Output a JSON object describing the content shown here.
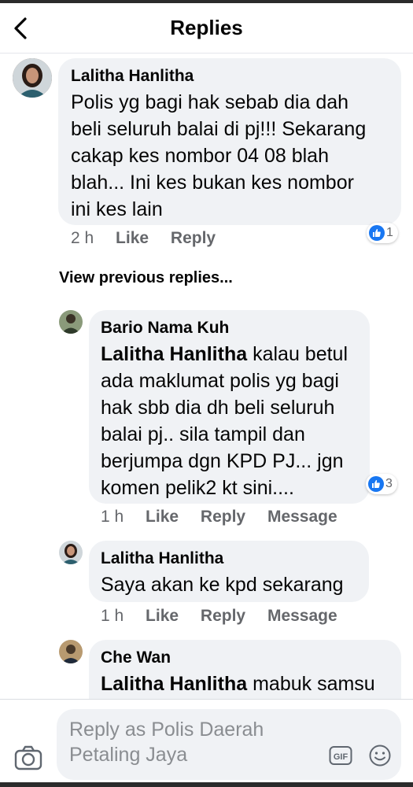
{
  "header": {
    "title": "Replies"
  },
  "comments": [
    {
      "author": "Lalitha Hanlitha",
      "lines": [
        "Polis yg bagi hak sebab dia dah",
        "beli seluruh balai di pj!!! Sekarang",
        "cakap kes nombor 04 08 blah",
        "blah... Ini kes bukan kes nombor",
        "ini kes lain"
      ],
      "time": "2 h",
      "like": "Like",
      "reply": "Reply",
      "reaction_count": "1"
    },
    {
      "author": "Bario Nama Kuh",
      "mention": "Lalitha Hanlitha",
      "first_line_rest": " kalau betul",
      "lines": [
        "ada maklumat polis yg bagi",
        "hak sbb dia dh beli seluruh",
        "balai pj.. sila tampil dan",
        "berjumpa dgn KPD PJ... jgn",
        "komen pelik2 kt sini...."
      ],
      "time": "1 h",
      "like": "Like",
      "reply": "Reply",
      "message": "Message",
      "reaction_count": "3"
    },
    {
      "author": "Lalitha Hanlitha",
      "lines": [
        "Saya akan ke kpd sekarang"
      ],
      "time": "1 h",
      "like": "Like",
      "reply": "Reply",
      "message": "Message"
    },
    {
      "author": "Che Wan",
      "mention": "Lalitha Hanlitha",
      "first_line_rest": " mabuk samsu"
    }
  ],
  "view_previous": "View previous replies...",
  "composer": {
    "placeholder_line1": "Reply as Polis Daerah",
    "placeholder_line2": "Petaling Jaya",
    "gif_label": "GIF"
  },
  "colors": {
    "bubble": "#f0f2f5",
    "accent": "#1877f2",
    "meta": "#65676b"
  },
  "icons": [
    "back-arrow-icon",
    "like-reaction-icon",
    "camera-icon",
    "gif-icon",
    "emoji-icon"
  ]
}
